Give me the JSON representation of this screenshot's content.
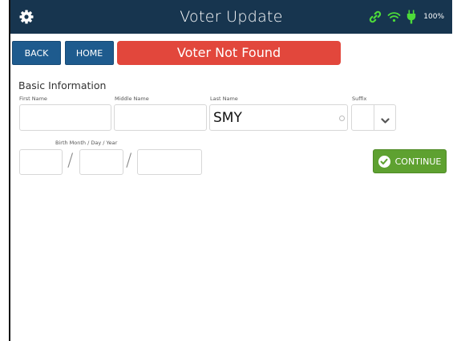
{
  "header": {
    "title": "Voter Update",
    "battery": "100%"
  },
  "nav": {
    "back_label": "BACK",
    "home_label": "HOME"
  },
  "banner": {
    "message": "Voter Not Found"
  },
  "form": {
    "section_title": "Basic Information",
    "first_name_label": "First Name",
    "middle_name_label": "Middle Name",
    "last_name_label": "Last Name",
    "suffix_label": "Suffix",
    "first_name_value": "",
    "middle_name_value": "",
    "last_name_value": "SMY",
    "suffix_value": "",
    "birth_label": "Birth Month / Day / Year",
    "birth_month": "",
    "birth_day": "",
    "birth_year": "",
    "separator": "/"
  },
  "actions": {
    "continue_label": "CONTINUE"
  },
  "colors": {
    "header_bg": "#17354f",
    "nav_button": "#1e5b8e",
    "error_banner": "#e2473c",
    "continue_button": "#5ea130",
    "status_green": "#4ddb3a"
  },
  "icons": [
    "gear-icon",
    "link-icon",
    "wifi-icon",
    "plug-icon",
    "clear-icon",
    "chevron-down-icon",
    "check-circle-icon"
  ]
}
